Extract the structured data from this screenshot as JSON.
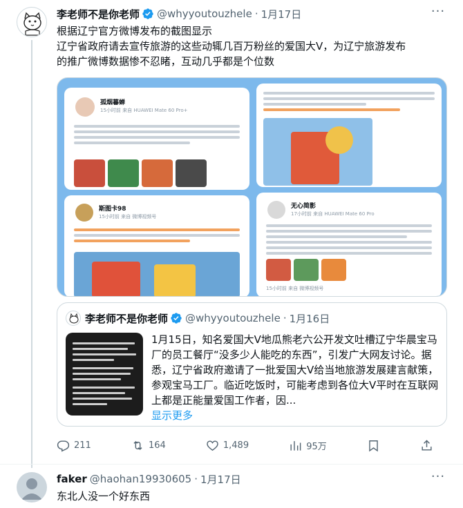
{
  "tweet": {
    "display_name": "李老师不是你老师",
    "handle": "@whyyoutouzhele",
    "date": "1月17日",
    "text_lines": [
      "根据辽宁官方微博发布的截图显示",
      "辽宁省政府请去宣传旅游的这些动辄几百万粉丝的爱国大V，为辽宁旅游发布",
      "的推广微博数据惨不忍睹，互动几乎都是个位数"
    ],
    "media": {
      "post1": {
        "name": "孤烟暮蝉",
        "meta": "15小时前 来自 HUAWEI Mate 60 Pro+"
      },
      "post2": {
        "name": "斯图卡98",
        "meta": "15小时前 来自 微博视频号"
      },
      "post3": {
        "name": "无心简影",
        "meta": "17小时前 来自 HUAWEI Mate 60 Pro"
      },
      "post4": {
        "meta": "15小时前 来自 微博视频号"
      }
    },
    "quote": {
      "display_name": "李老师不是你老师",
      "handle": "@whyyoutouzhele",
      "date": "1月16日",
      "text": "1月15日，知名爱国大V地瓜熊老六公开发文吐槽辽宁华晨宝马厂的员工餐厅“没多少人能吃的东西”，引发广大网友讨论。据悉，辽宁省政府邀请了一批爱国大V给当地旅游发展建言献策，参观宝马工厂。临近吃饭时，可能考虑到各位大V平时在互联网上都是正能量爱国工作者，因...",
      "show_more": "显示更多"
    },
    "actions": {
      "replies": "211",
      "retweets": "164",
      "likes": "1,489",
      "views": "95万"
    }
  },
  "reply": {
    "display_name": "faker",
    "handle": "@haohan19930605",
    "date": "1月17日",
    "text": "东北人没一个好东西"
  },
  "colors": {
    "verified": "#1d9bf0",
    "secondary_text": "#536471",
    "link": "#1d9bf0",
    "media_bg": "#7db9ec"
  }
}
